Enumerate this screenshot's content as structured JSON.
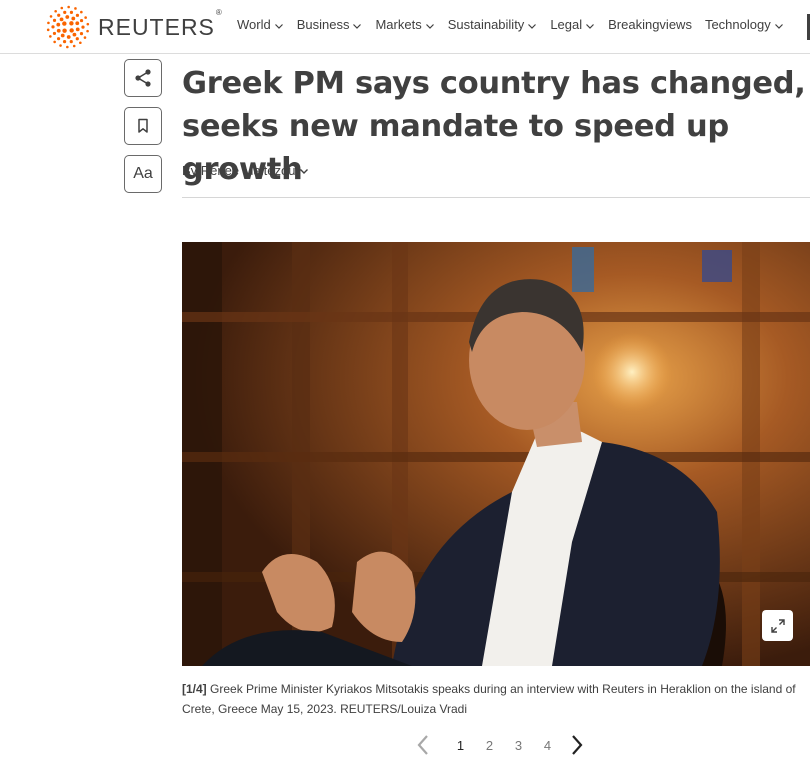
{
  "header": {
    "brand": "REUTERS",
    "brand_mark": "®",
    "nav": [
      {
        "label": "World",
        "has_dropdown": true
      },
      {
        "label": "Business",
        "has_dropdown": true
      },
      {
        "label": "Markets",
        "has_dropdown": true
      },
      {
        "label": "Sustainability",
        "has_dropdown": true
      },
      {
        "label": "Legal",
        "has_dropdown": true
      },
      {
        "label": "Breakingviews",
        "has_dropdown": false
      },
      {
        "label": "Technology",
        "has_dropdown": true
      }
    ]
  },
  "actions": {
    "share_icon": "share-icon",
    "bookmark_icon": "bookmark-icon",
    "text_size_label": "Aa"
  },
  "article": {
    "headline": "Greek PM says country has changed, seeks new mandate to speed up growth",
    "byline": "By Renee Maltezou"
  },
  "gallery": {
    "counter": "[1/4]",
    "caption": "Greek Prime Minister Kyriakos Mitsotakis speaks during an interview with Reuters in Heraklion on the island of Crete, Greece May 15, 2023. REUTERS/Louiza Vradi",
    "expand_icon": "expand-icon",
    "pages": [
      "1",
      "2",
      "3",
      "4"
    ],
    "active_page": "1"
  },
  "colors": {
    "brand_orange": "#fa6400",
    "text": "#404040",
    "divider": "#d6d6d6"
  }
}
